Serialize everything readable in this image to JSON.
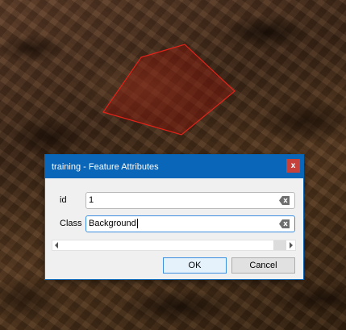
{
  "dialog": {
    "title": "training - Feature Attributes",
    "close_label": "x",
    "fields": [
      {
        "label": "id",
        "value": "1"
      },
      {
        "label": "Class",
        "value": "Background"
      }
    ],
    "buttons": {
      "ok": "OK",
      "cancel": "Cancel"
    }
  },
  "colors": {
    "titlebar": "#0a66b8",
    "close_button": "#c4413c",
    "polygon_stroke": "#e2231a"
  }
}
